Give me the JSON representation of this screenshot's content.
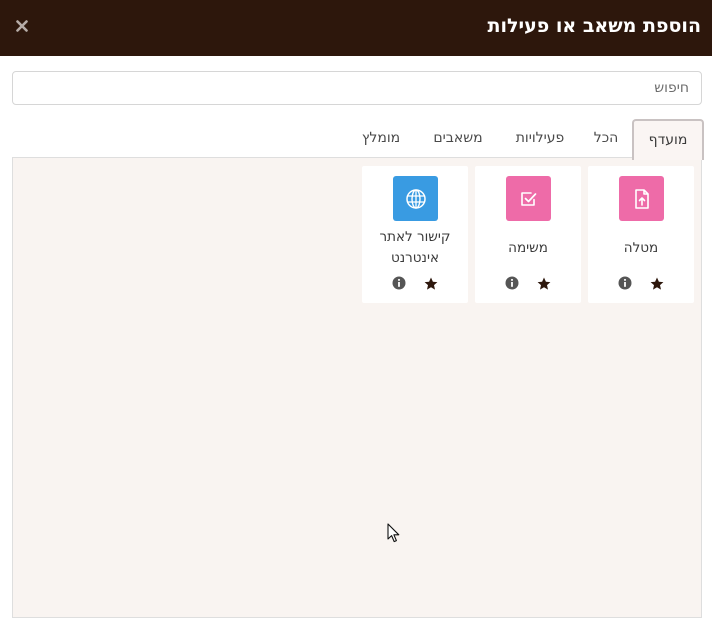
{
  "dialog": {
    "title": "הוספת משאב או פעילות"
  },
  "search": {
    "placeholder": "חיפוש",
    "value": ""
  },
  "tabs": [
    {
      "label": "מועדף",
      "active": true
    },
    {
      "label": "הכל",
      "active": false
    },
    {
      "label": "פעילויות",
      "active": false
    },
    {
      "label": "משאבים",
      "active": false
    },
    {
      "label": "מומלץ",
      "active": false
    }
  ],
  "items": [
    {
      "name": "מטלה",
      "icon": "assignment-upload-icon",
      "color": "#ee6ba8"
    },
    {
      "name": "משימה",
      "icon": "checkbox-icon",
      "color": "#ee6ba8"
    },
    {
      "name": "קישור לאתר אינטרנט",
      "icon": "globe-icon",
      "color": "#399be2"
    }
  ],
  "colors": {
    "header_bg": "#2d170c",
    "panel_bg": "#f9f4f1",
    "star": "#2d170c"
  }
}
